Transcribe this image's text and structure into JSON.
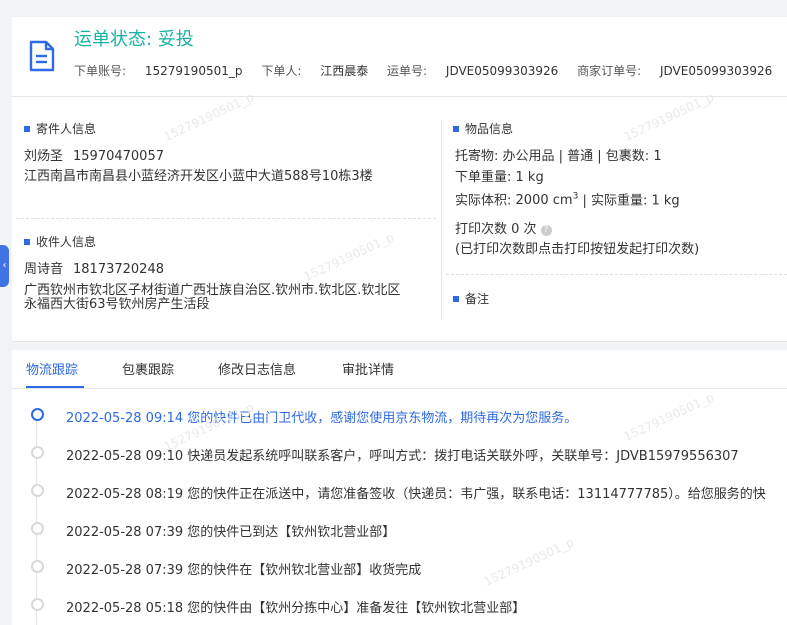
{
  "header": {
    "status": "运单状态: 妥投",
    "account_label": "下单账号:",
    "account": "15279190501_p",
    "orderer_label": "下单人:",
    "orderer": "江西晨泰",
    "waybill_label": "运单号:",
    "waybill": "JDVE05099303926",
    "merchant_label": "商家订单号:",
    "merchant_order": "JDVE05099303926",
    "icon": "document-icon"
  },
  "sender": {
    "title": "寄件人信息",
    "name": "刘炀圣",
    "phone": "15970470057",
    "address": "江西南昌市南昌县小蓝经济开发区小蓝中大道588号10栋3楼"
  },
  "receiver": {
    "title": "收件人信息",
    "name": "周诗音",
    "phone": "18173720248",
    "address_line1": "广西钦州市钦北区子材街道广西壮族自治区.钦州市.钦北区.钦北区",
    "address_line2": "永福西大街63号钦州房产生活段"
  },
  "goods": {
    "title": "物品信息",
    "line1": "托寄物:  办公用品 | 普通 | 包裹数:  1",
    "line2": "下单重量:  1 kg",
    "volume_label": "实际体积:",
    "volume_value": "2000 cm",
    "volume_sup": "3",
    "weight_text": "| 实际重量:  1 kg",
    "print_count": "打印次数   0 次",
    "print_note": "(已打印次数即点击打印按钮发起打印次数)"
  },
  "remark": {
    "title": "备注"
  },
  "collapse": {
    "glyph": "‹"
  },
  "tabs": [
    {
      "label": "物流跟踪",
      "active": true
    },
    {
      "label": "包裹跟踪",
      "active": false
    },
    {
      "label": "修改日志信息",
      "active": false
    },
    {
      "label": "审批详情",
      "active": false
    }
  ],
  "timeline": [
    {
      "text": "2022-05-28 09:14  您的快件已由门卫代收，感谢您使用京东物流，期待再次为您服务。",
      "active": true
    },
    {
      "text": "2022-05-28 09:10  快递员发起系统呼叫联系客户，呼叫方式：拨打电话关联外呼，关联单号：JDVB15979556307",
      "active": false
    },
    {
      "text": "2022-05-28 08:19  您的快件正在派送中，请您准备签收（快递员：韦广强，联系电话：13114777785）。给您服务的快",
      "active": false
    },
    {
      "text": "2022-05-28 07:39  您的快件已到达【钦州钦北营业部】",
      "active": false
    },
    {
      "text": "2022-05-28 07:39  您的快件在【钦州钦北营业部】收货完成",
      "active": false
    },
    {
      "text": "2022-05-28 05:18  您的快件由【钦州分拣中心】准备发往【钦州钦北营业部】",
      "active": false
    }
  ],
  "watermark": "15279190501_p",
  "colors": {
    "accent": "#2d6ae3",
    "status": "#17b3a3"
  }
}
